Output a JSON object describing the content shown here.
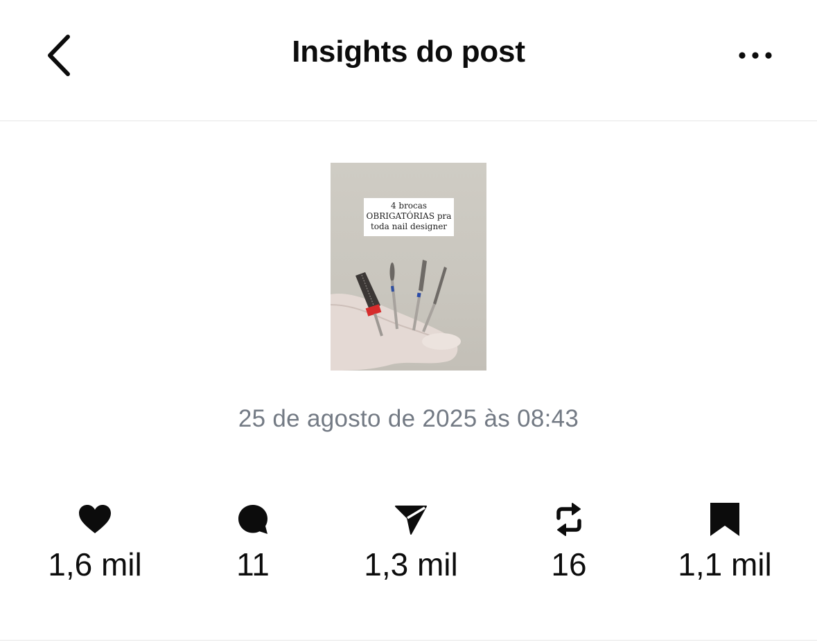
{
  "header": {
    "title": "Insights do post",
    "back_icon": "chevron-left-icon",
    "more_icon": "more-horizontal-icon"
  },
  "post": {
    "thumbnail_caption": [
      "4 brocas",
      "OBRIGATÓRIAS pra",
      "toda nail designer"
    ],
    "timestamp": "25 de agosto de 2025 às 08:43"
  },
  "stats": [
    {
      "icon": "heart-icon",
      "value": "1,6 mil"
    },
    {
      "icon": "comment-icon",
      "value": "11"
    },
    {
      "icon": "send-icon",
      "value": "1,3 mil"
    },
    {
      "icon": "repost-icon",
      "value": "16"
    },
    {
      "icon": "bookmark-icon",
      "value": "1,1 mil"
    }
  ],
  "colors": {
    "text": "#0c0c0c",
    "muted": "#737a84",
    "divider": "#e6e6e6"
  }
}
